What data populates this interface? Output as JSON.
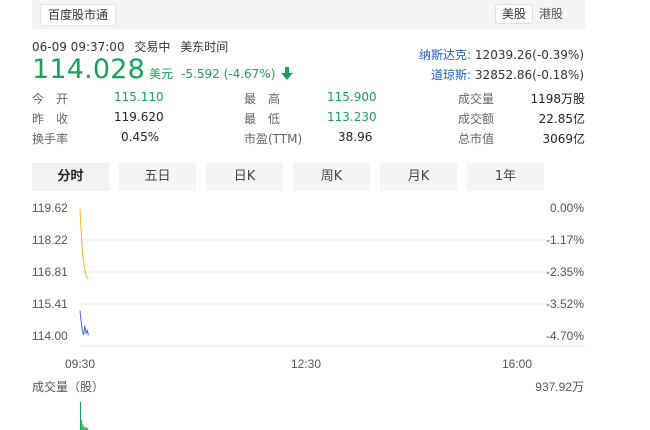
{
  "header": {
    "brand": "百度股市通",
    "markets": [
      "美股",
      "港股"
    ]
  },
  "quote": {
    "datetime": "06-09 09:37:00",
    "status": "交易中",
    "timezone": "美东时间",
    "price": "114.028",
    "currency": "美元",
    "change": "-5.592 (-4.67%)",
    "direction": "down"
  },
  "indexes": [
    {
      "name": "纳斯达克:",
      "value": "12039.26(-0.39%)"
    },
    {
      "name": "道琼斯:",
      "value": "32852.86(-0.18%)"
    }
  ],
  "stats": {
    "open_label": "今　开",
    "open": "115.110",
    "prev_label": "昨　收",
    "prev": "119.620",
    "turnover_label": "换手率",
    "turnover": "0.45%",
    "high_label": "最　高",
    "high": "115.900",
    "low_label": "最　低",
    "low": "113.230",
    "pe_label": "市盈(TTM)",
    "pe": "38.96",
    "volume_label": "成交量",
    "volume": "1198万股",
    "amount_label": "成交额",
    "amount": "22.85亿",
    "mcap_label": "总市值",
    "mcap": "3069亿"
  },
  "tabs": [
    "分时",
    "五日",
    "日K",
    "周K",
    "月K",
    "1年"
  ],
  "active_tab": "分时",
  "colors": {
    "down": "#1ba05a",
    "link": "#1f5fbf",
    "price_line": "#4a67e8",
    "avg_line": "#f0b429",
    "volume_bar": "#1ba05a"
  },
  "chart_data": {
    "type": "line",
    "y_labels_left": [
      "119.62",
      "118.22",
      "116.81",
      "115.41",
      "114.00"
    ],
    "y_labels_right": [
      "0.00%",
      "-1.17%",
      "-2.35%",
      "-3.52%",
      "-4.70%"
    ],
    "ylim": [
      114.0,
      119.62
    ],
    "x_ticks": [
      "09:30",
      "12:30",
      "16:00"
    ],
    "volume_label": "成交量（股）",
    "volume_max": "937.92万",
    "series": [
      {
        "x": [
          "09:30",
          "09:31",
          "09:32",
          "09:33",
          "09:34",
          "09:35",
          "09:36",
          "09:37"
        ],
        "values": [
          115.11,
          114.6,
          114.2,
          114.05,
          114.45,
          114.1,
          114.25,
          114.028
        ]
      },
      {
        "x": [
          "09:30",
          "09:31",
          "09:32",
          "09:33",
          "09:34",
          "09:35",
          "09:36",
          "09:37"
        ],
        "values": [
          119.6,
          118.6,
          117.7,
          117.2,
          116.9,
          116.7,
          116.55,
          116.5
        ]
      }
    ]
  }
}
